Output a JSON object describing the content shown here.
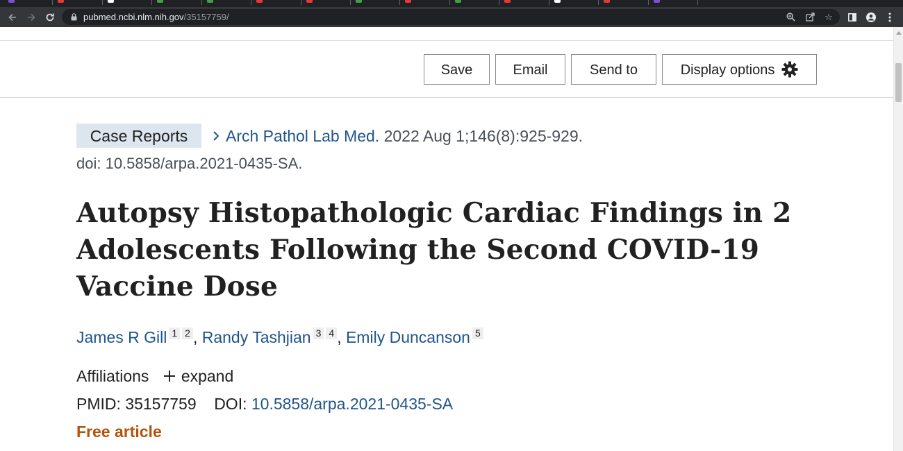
{
  "browser": {
    "url_host": "pubmed.ncbi.nlm.nih.gov",
    "url_path": "/35157759/",
    "tab_favicon_colors": [
      "#7b4fd8",
      "#e53935",
      "#ffffff",
      "#43a047",
      "#43a047",
      "#e53935",
      "#e53935",
      "#43a047",
      "#e53935",
      "#43a047",
      "#e53935",
      "#ffffff",
      "#e53935",
      "#7b4fd8"
    ]
  },
  "actions": {
    "save": "Save",
    "email": "Email",
    "send_to": "Send to",
    "display_options": "Display options"
  },
  "article": {
    "type": "Case Reports",
    "journal": "Arch Pathol Lab Med.",
    "citation": "2022 Aug 1;146(8):925-929.",
    "doi_line": "doi: 10.5858/arpa.2021-0435-SA.",
    "title": "Autopsy Histopathologic Cardiac Findings in 2 Adolescents Following the Second COVID-19 Vaccine Dose",
    "authors": [
      {
        "name": "James R Gill",
        "affils": [
          "1",
          "2"
        ]
      },
      {
        "name": "Randy Tashjian",
        "affils": [
          "3",
          "4"
        ]
      },
      {
        "name": "Emily Duncanson",
        "affils": [
          "5"
        ]
      }
    ],
    "affiliations_label": "Affiliations",
    "expand_label": "expand",
    "pmid_label": "PMID:",
    "pmid": "35157759",
    "doi_label": "DOI:",
    "doi": "10.5858/arpa.2021-0435-SA",
    "free_label": "Free article"
  },
  "colors": {
    "link": "#20558a",
    "free": "#b45309",
    "type_badge_bg": "#dde6ef"
  }
}
